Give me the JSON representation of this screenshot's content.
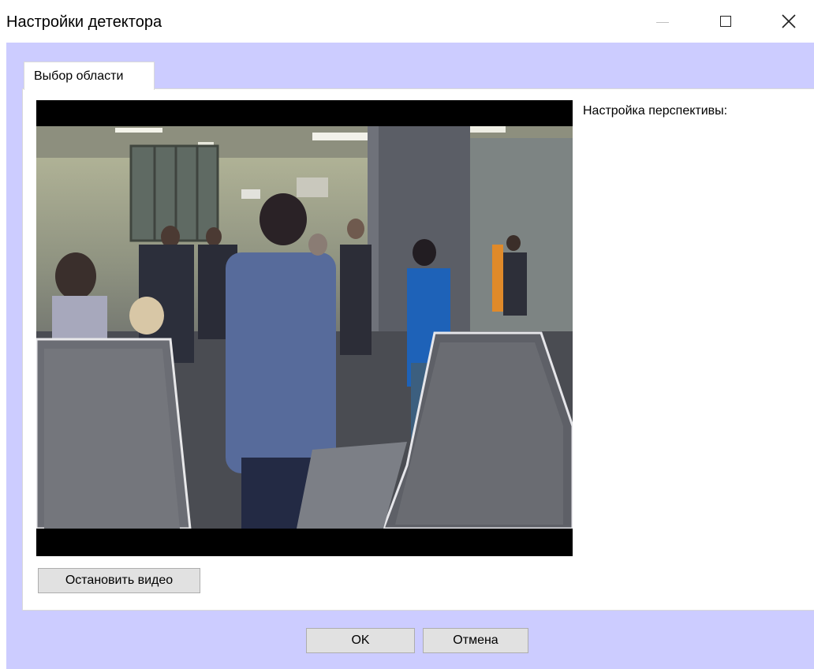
{
  "window": {
    "title": "Настройки детектора"
  },
  "tabs": [
    {
      "label": "Выбор области",
      "selected": true
    }
  ],
  "main": {
    "perspective_label": "Настройка перспективы:",
    "stop_video_label": "Остановить видео"
  },
  "footer": {
    "ok_label": "OK",
    "cancel_label": "Отмена"
  },
  "colors": {
    "client_background": "#ccccff",
    "button_face": "#e1e1e1",
    "button_border": "#adadad"
  }
}
